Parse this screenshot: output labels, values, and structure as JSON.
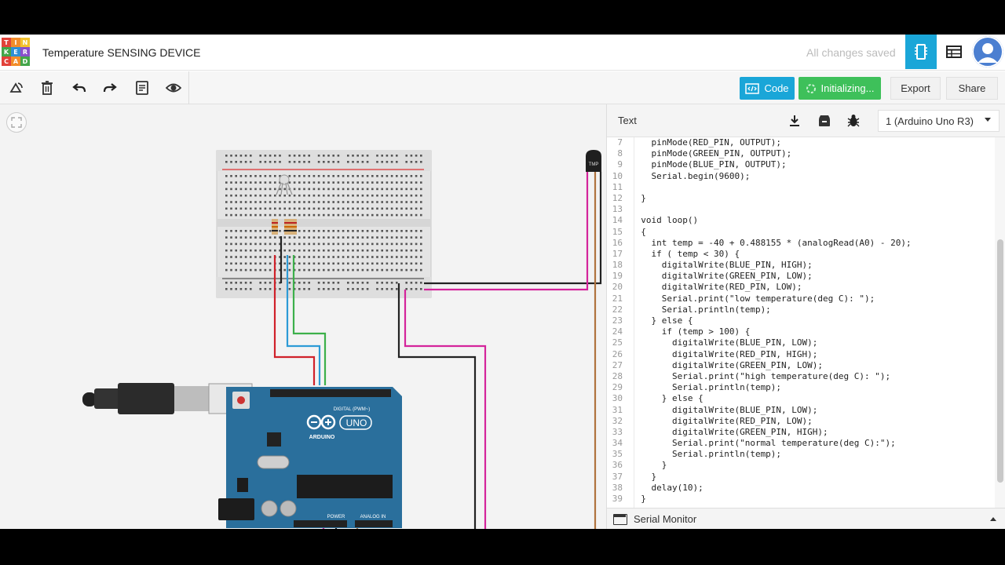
{
  "app": {
    "logo_letters": [
      "T",
      "I",
      "N",
      "K",
      "E",
      "R",
      "C",
      "A",
      "D"
    ],
    "logo_colors": [
      "#e2423a",
      "#f28d2a",
      "#f2c22f",
      "#44a64a",
      "#2f8fd6",
      "#8a4fcc",
      "#e2423a",
      "#f28d2a",
      "#44a64a"
    ],
    "title": "Temperature SENSING DEVICE",
    "status": "All changes saved"
  },
  "toolbar": {
    "code_label": "Code",
    "simulate_label": "Initializing...",
    "export_label": "Export",
    "share_label": "Share"
  },
  "code_panel": {
    "mode_label": "Text",
    "device_label": "1 (Arduino Uno R3)",
    "serial_monitor_label": "Serial Monitor",
    "lines": [
      {
        "n": "7",
        "text": "  pinMode(RED_PIN, OUTPUT);"
      },
      {
        "n": "8",
        "text": "  pinMode(GREEN_PIN, OUTPUT);"
      },
      {
        "n": "9",
        "text": "  pinMode(BLUE_PIN, OUTPUT);"
      },
      {
        "n": "10",
        "text": "  Serial.begin(9600);"
      },
      {
        "n": "11",
        "text": ""
      },
      {
        "n": "12",
        "text": "}"
      },
      {
        "n": "13",
        "text": ""
      },
      {
        "n": "14",
        "text": "void loop()"
      },
      {
        "n": "15",
        "text": "{"
      },
      {
        "n": "16",
        "text": "  int temp = -40 + 0.488155 * (analogRead(A0) - 20);"
      },
      {
        "n": "17",
        "text": "  if ( temp < 30) {"
      },
      {
        "n": "18",
        "text": "    digitalWrite(BLUE_PIN, HIGH);"
      },
      {
        "n": "19",
        "text": "    digitalWrite(GREEN_PIN, LOW);"
      },
      {
        "n": "20",
        "text": "    digitalWrite(RED_PIN, LOW);"
      },
      {
        "n": "21",
        "text": "    Serial.print(\"low temperature(deg C): \");"
      },
      {
        "n": "22",
        "text": "    Serial.println(temp);"
      },
      {
        "n": "23",
        "text": "  } else {"
      },
      {
        "n": "24",
        "text": "    if (temp > 100) {"
      },
      {
        "n": "25",
        "text": "      digitalWrite(BLUE_PIN, LOW);"
      },
      {
        "n": "26",
        "text": "      digitalWrite(RED_PIN, HIGH);"
      },
      {
        "n": "27",
        "text": "      digitalWrite(GREEN_PIN, LOW);"
      },
      {
        "n": "28",
        "text": "      Serial.print(\"high temperature(deg C): \");"
      },
      {
        "n": "29",
        "text": "      Serial.println(temp);"
      },
      {
        "n": "30",
        "text": "    } else {"
      },
      {
        "n": "31",
        "text": "      digitalWrite(BLUE_PIN, LOW);"
      },
      {
        "n": "32",
        "text": "      digitalWrite(RED_PIN, LOW);"
      },
      {
        "n": "33",
        "text": "      digitalWrite(GREEN_PIN, HIGH);"
      },
      {
        "n": "34",
        "text": "      Serial.print(\"normal temperature(deg C):\");"
      },
      {
        "n": "35",
        "text": "      Serial.println(temp);"
      },
      {
        "n": "36",
        "text": "    }"
      },
      {
        "n": "37",
        "text": "  }"
      },
      {
        "n": "38",
        "text": "  delay(10);"
      },
      {
        "n": "39",
        "text": "}"
      }
    ]
  },
  "circuit": {
    "sensor_label": "TMP",
    "board_brand": "ARDUINO",
    "board_model": "UNO",
    "board_header_digital": "DIGITAL (PWM~)",
    "board_header_power": "POWER",
    "board_header_analog": "ANALOG IN"
  },
  "colors": {
    "accent_blue": "#1aa6d8",
    "simulate_green": "#3ec05a",
    "board_blue": "#2a6f9c",
    "wire_red": "#d0212a",
    "wire_blue": "#2d9bd6",
    "wire_green": "#3cb04a",
    "wire_magenta": "#d4249b",
    "wire_black": "#222222",
    "wire_brown": "#b0733e"
  }
}
